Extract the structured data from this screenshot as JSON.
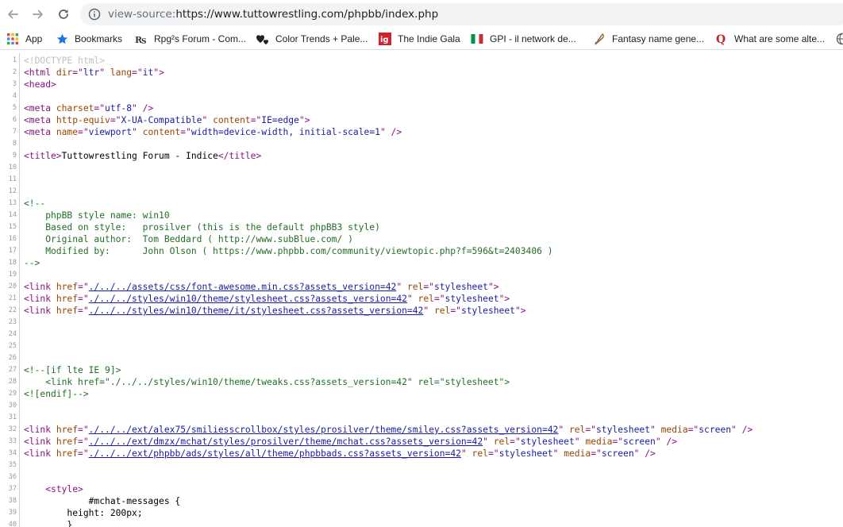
{
  "browser": {
    "url_prefix": "view-source:",
    "url_main": "https://www.tuttowrestling.com/phpbb/index.php"
  },
  "bookmarks": [
    {
      "label": "App",
      "icon": "apps-grid-icon"
    },
    {
      "label": "Bookmarks",
      "icon": "star-icon"
    },
    {
      "label": "Rpg²s Forum - Com...",
      "icon": "rpg-forum-icon"
    },
    {
      "label": "Color Trends + Pale...",
      "icon": "hearts-icon"
    },
    {
      "label": "The Indie Gala",
      "icon": "ig-icon"
    },
    {
      "label": "GPI - il network de...",
      "icon": "italy-flag-icon"
    },
    {
      "label": "Fantasy name gene...",
      "icon": "quill-icon"
    },
    {
      "label": "What are some alte...",
      "icon": "quora-icon"
    }
  ],
  "source_lines": [
    {
      "n": "1",
      "segs": [
        {
          "t": "<!DOCTYPE html>",
          "c": "dt"
        }
      ]
    },
    {
      "n": "2",
      "segs": [
        {
          "t": "<html ",
          "c": "tag"
        },
        {
          "t": "dir",
          "c": "an"
        },
        {
          "t": "=\"",
          "c": "tag"
        },
        {
          "t": "ltr",
          "c": "av"
        },
        {
          "t": "\" ",
          "c": "tag"
        },
        {
          "t": "lang",
          "c": "an"
        },
        {
          "t": "=\"",
          "c": "tag"
        },
        {
          "t": "it",
          "c": "av"
        },
        {
          "t": "\">",
          "c": "tag"
        }
      ]
    },
    {
      "n": "3",
      "segs": [
        {
          "t": "<head>",
          "c": "tag"
        }
      ]
    },
    {
      "n": "4",
      "segs": []
    },
    {
      "n": "5",
      "segs": [
        {
          "t": "<meta ",
          "c": "tag"
        },
        {
          "t": "charset",
          "c": "an"
        },
        {
          "t": "=\"",
          "c": "tag"
        },
        {
          "t": "utf-8",
          "c": "av"
        },
        {
          "t": "\" />",
          "c": "tag"
        }
      ]
    },
    {
      "n": "6",
      "segs": [
        {
          "t": "<meta ",
          "c": "tag"
        },
        {
          "t": "http-equiv",
          "c": "an"
        },
        {
          "t": "=\"",
          "c": "tag"
        },
        {
          "t": "X-UA-Compatible",
          "c": "av"
        },
        {
          "t": "\" ",
          "c": "tag"
        },
        {
          "t": "content",
          "c": "an"
        },
        {
          "t": "=\"",
          "c": "tag"
        },
        {
          "t": "IE=edge",
          "c": "av"
        },
        {
          "t": "\">",
          "c": "tag"
        }
      ]
    },
    {
      "n": "7",
      "segs": [
        {
          "t": "<meta ",
          "c": "tag"
        },
        {
          "t": "name",
          "c": "an"
        },
        {
          "t": "=\"",
          "c": "tag"
        },
        {
          "t": "viewport",
          "c": "av"
        },
        {
          "t": "\" ",
          "c": "tag"
        },
        {
          "t": "content",
          "c": "an"
        },
        {
          "t": "=\"",
          "c": "tag"
        },
        {
          "t": "width=device-width, initial-scale=1",
          "c": "av"
        },
        {
          "t": "\" />",
          "c": "tag"
        }
      ]
    },
    {
      "n": "8",
      "segs": []
    },
    {
      "n": "9",
      "segs": [
        {
          "t": "<title>",
          "c": "tag"
        },
        {
          "t": "Tuttowrestling Forum - Indice",
          "c": "tx"
        },
        {
          "t": "</title>",
          "c": "tag"
        }
      ]
    },
    {
      "n": "10",
      "segs": []
    },
    {
      "n": "11",
      "segs": []
    },
    {
      "n": "12",
      "segs": []
    },
    {
      "n": "13",
      "segs": [
        {
          "t": "<!--",
          "c": "cm"
        }
      ]
    },
    {
      "n": "14",
      "segs": [
        {
          "t": "    phpBB style name: win10",
          "c": "cm"
        }
      ]
    },
    {
      "n": "15",
      "segs": [
        {
          "t": "    Based on style:   prosilver (this is the default phpBB3 style)",
          "c": "cm"
        }
      ]
    },
    {
      "n": "16",
      "segs": [
        {
          "t": "    Original author:  Tom Beddard ( http://www.subBlue.com/ )",
          "c": "cm"
        }
      ]
    },
    {
      "n": "17",
      "segs": [
        {
          "t": "    Modified by:      John Olson ( https://www.phpbb.com/community/viewtopic.php?f=596&t=2403406 )",
          "c": "cm"
        }
      ]
    },
    {
      "n": "18",
      "segs": [
        {
          "t": "-->",
          "c": "cm"
        }
      ]
    },
    {
      "n": "19",
      "segs": []
    },
    {
      "n": "20",
      "segs": [
        {
          "t": "<link ",
          "c": "tag"
        },
        {
          "t": "href",
          "c": "an"
        },
        {
          "t": "=\"",
          "c": "tag"
        },
        {
          "t": "./../../assets/css/font-awesome.min.css?assets_version=42",
          "c": "lk"
        },
        {
          "t": "\" ",
          "c": "tag"
        },
        {
          "t": "rel",
          "c": "an"
        },
        {
          "t": "=\"",
          "c": "tag"
        },
        {
          "t": "stylesheet",
          "c": "av"
        },
        {
          "t": "\">",
          "c": "tag"
        }
      ]
    },
    {
      "n": "21",
      "segs": [
        {
          "t": "<link ",
          "c": "tag"
        },
        {
          "t": "href",
          "c": "an"
        },
        {
          "t": "=\"",
          "c": "tag"
        },
        {
          "t": "./../../styles/win10/theme/stylesheet.css?assets_version=42",
          "c": "lk"
        },
        {
          "t": "\" ",
          "c": "tag"
        },
        {
          "t": "rel",
          "c": "an"
        },
        {
          "t": "=\"",
          "c": "tag"
        },
        {
          "t": "stylesheet",
          "c": "av"
        },
        {
          "t": "\">",
          "c": "tag"
        }
      ]
    },
    {
      "n": "22",
      "segs": [
        {
          "t": "<link ",
          "c": "tag"
        },
        {
          "t": "href",
          "c": "an"
        },
        {
          "t": "=\"",
          "c": "tag"
        },
        {
          "t": "./../../styles/win10/theme/it/stylesheet.css?assets_version=42",
          "c": "lk"
        },
        {
          "t": "\" ",
          "c": "tag"
        },
        {
          "t": "rel",
          "c": "an"
        },
        {
          "t": "=\"",
          "c": "tag"
        },
        {
          "t": "stylesheet",
          "c": "av"
        },
        {
          "t": "\">",
          "c": "tag"
        }
      ]
    },
    {
      "n": "23",
      "segs": []
    },
    {
      "n": "24",
      "segs": []
    },
    {
      "n": "25",
      "segs": []
    },
    {
      "n": "26",
      "segs": []
    },
    {
      "n": "27",
      "segs": [
        {
          "t": "<!--[if lte IE 9]>",
          "c": "cm"
        }
      ]
    },
    {
      "n": "28",
      "segs": [
        {
          "t": "    <link href=\"./../../styles/win10/theme/tweaks.css?assets_version=42\" rel=\"stylesheet\">",
          "c": "cm"
        }
      ]
    },
    {
      "n": "29",
      "segs": [
        {
          "t": "<![endif]-->",
          "c": "cm"
        }
      ]
    },
    {
      "n": "30",
      "segs": []
    },
    {
      "n": "31",
      "segs": []
    },
    {
      "n": "32",
      "segs": [
        {
          "t": "<link ",
          "c": "tag"
        },
        {
          "t": "href",
          "c": "an"
        },
        {
          "t": "=\"",
          "c": "tag"
        },
        {
          "t": "./../../ext/alex75/smiliesscrollbox/styles/prosilver/theme/smiley.css?assets_version=42",
          "c": "lk"
        },
        {
          "t": "\" ",
          "c": "tag"
        },
        {
          "t": "rel",
          "c": "an"
        },
        {
          "t": "=\"",
          "c": "tag"
        },
        {
          "t": "stylesheet",
          "c": "av"
        },
        {
          "t": "\" ",
          "c": "tag"
        },
        {
          "t": "media",
          "c": "an"
        },
        {
          "t": "=\"",
          "c": "tag"
        },
        {
          "t": "screen",
          "c": "av"
        },
        {
          "t": "\" />",
          "c": "tag"
        }
      ]
    },
    {
      "n": "33",
      "segs": [
        {
          "t": "<link ",
          "c": "tag"
        },
        {
          "t": "href",
          "c": "an"
        },
        {
          "t": "=\"",
          "c": "tag"
        },
        {
          "t": "./../../ext/dmzx/mchat/styles/prosilver/theme/mchat.css?assets_version=42",
          "c": "lk"
        },
        {
          "t": "\" ",
          "c": "tag"
        },
        {
          "t": "rel",
          "c": "an"
        },
        {
          "t": "=\"",
          "c": "tag"
        },
        {
          "t": "stylesheet",
          "c": "av"
        },
        {
          "t": "\" ",
          "c": "tag"
        },
        {
          "t": "media",
          "c": "an"
        },
        {
          "t": "=\"",
          "c": "tag"
        },
        {
          "t": "screen",
          "c": "av"
        },
        {
          "t": "\" />",
          "c": "tag"
        }
      ]
    },
    {
      "n": "34",
      "segs": [
        {
          "t": "<link ",
          "c": "tag"
        },
        {
          "t": "href",
          "c": "an"
        },
        {
          "t": "=\"",
          "c": "tag"
        },
        {
          "t": "./../../ext/phpbb/ads/styles/all/theme/phpbbads.css?assets_version=42",
          "c": "lk"
        },
        {
          "t": "\" ",
          "c": "tag"
        },
        {
          "t": "rel",
          "c": "an"
        },
        {
          "t": "=\"",
          "c": "tag"
        },
        {
          "t": "stylesheet",
          "c": "av"
        },
        {
          "t": "\" ",
          "c": "tag"
        },
        {
          "t": "media",
          "c": "an"
        },
        {
          "t": "=\"",
          "c": "tag"
        },
        {
          "t": "screen",
          "c": "av"
        },
        {
          "t": "\" />",
          "c": "tag"
        }
      ]
    },
    {
      "n": "35",
      "segs": []
    },
    {
      "n": "36",
      "segs": []
    },
    {
      "n": "37",
      "segs": [
        {
          "t": "    ",
          "c": "tx"
        },
        {
          "t": "<style>",
          "c": "tag"
        }
      ]
    },
    {
      "n": "38",
      "segs": [
        {
          "t": "            #mchat-messages {",
          "c": "tx"
        }
      ]
    },
    {
      "n": "39",
      "segs": [
        {
          "t": "        height: 200px;",
          "c": "tx"
        }
      ]
    },
    {
      "n": "40",
      "segs": [
        {
          "t": "        }",
          "c": "tx"
        }
      ]
    }
  ]
}
